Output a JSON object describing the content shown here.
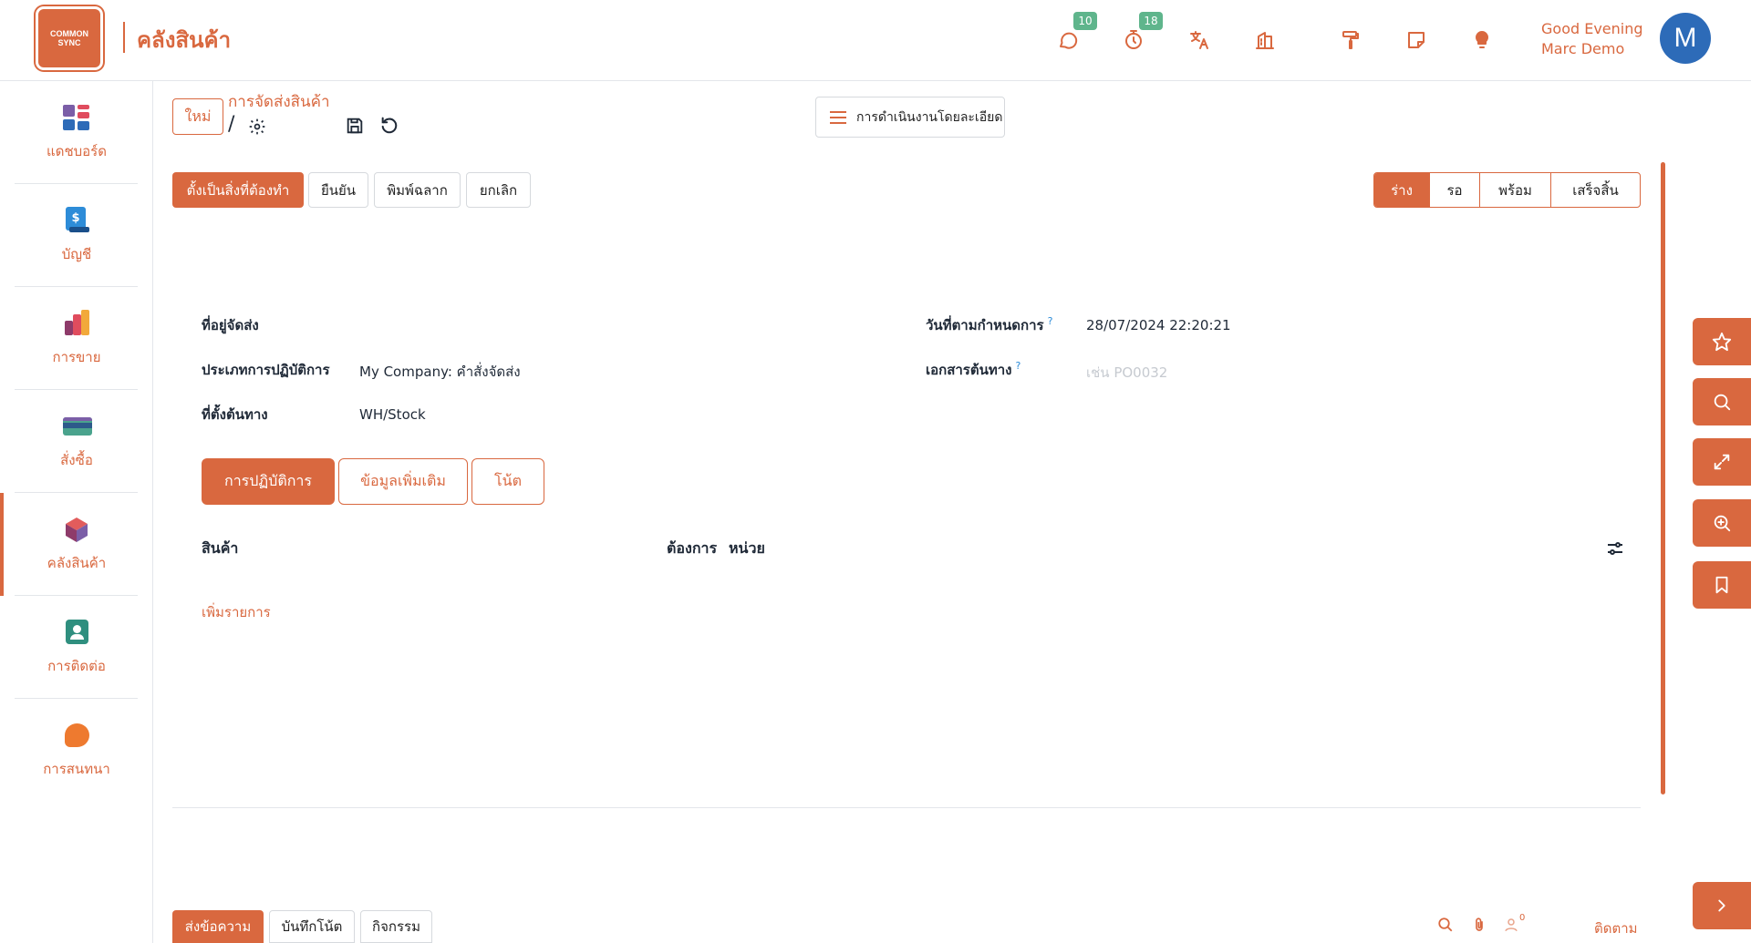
{
  "header": {
    "logo_line1": "COMMON",
    "logo_line2": "SYNC",
    "app_title": "คลังสินค้า",
    "badges": {
      "messages": "10",
      "activities": "18"
    },
    "greeting_line1": "Good Evening",
    "greeting_line2": "Marc Demo",
    "avatar_letter": "M"
  },
  "sidebar": {
    "items": [
      {
        "label": "แดชบอร์ด",
        "icon": "dashboard-icon"
      },
      {
        "label": "บัญชี",
        "icon": "accounting-icon"
      },
      {
        "label": "การขาย",
        "icon": "sales-icon"
      },
      {
        "label": "สั่งซื้อ",
        "icon": "purchase-icon"
      },
      {
        "label": "คลังสินค้า",
        "icon": "inventory-icon",
        "active": true
      },
      {
        "label": "การติดต่อ",
        "icon": "contacts-icon"
      },
      {
        "label": "การสนทนา",
        "icon": "discuss-icon"
      }
    ]
  },
  "breadcrumb": {
    "new_label": "ใหม่",
    "parent": "การจัดส่งสินค้า",
    "slash": "/"
  },
  "actions_menu_label": "การดำเนินงานโดยละเอียด",
  "action_buttons": {
    "mark_todo": "ตั้งเป็นสิ่งที่ต้องทำ",
    "validate": "ยืนยัน",
    "print_labels": "พิมพ์ฉลาก",
    "cancel": "ยกเลิก"
  },
  "status_steps": [
    "ร่าง",
    "รอ",
    "พร้อม",
    "เสร็จสิ้น"
  ],
  "form": {
    "delivery_address_label": "ที่อยู่จัดส่ง",
    "operation_type_label": "ประเภทการปฏิบัติการ",
    "operation_type_value": "My Company: คำสั่งจัดส่ง",
    "source_location_label": "ที่ตั้งต้นทาง",
    "source_location_value": "WH/Stock",
    "scheduled_date_label": "วันที่ตามกำหนดการ",
    "scheduled_date_value": "28/07/2024 22:20:21",
    "source_document_label": "เอกสารต้นทาง",
    "source_document_placeholder": "เช่น PO0032",
    "help_mark": "?"
  },
  "tabs": [
    "การปฏิบัติการ",
    "ข้อมูลเพิ่มเติม",
    "โน้ต"
  ],
  "table": {
    "col_product": "สินค้า",
    "col_demand": "ต้องการ",
    "col_unit": "หน่วย",
    "add_line": "เพิ่มรายการ"
  },
  "chatter": {
    "send_message": "ส่งข้อความ",
    "log_note": "บันทึกโน้ต",
    "activities": "กิจกรรม",
    "follower_count": "0",
    "follow": "ติดตาม"
  },
  "colors": {
    "accent": "#d9683f",
    "badge": "#5fb58c",
    "avatar": "#2d6bb8"
  }
}
